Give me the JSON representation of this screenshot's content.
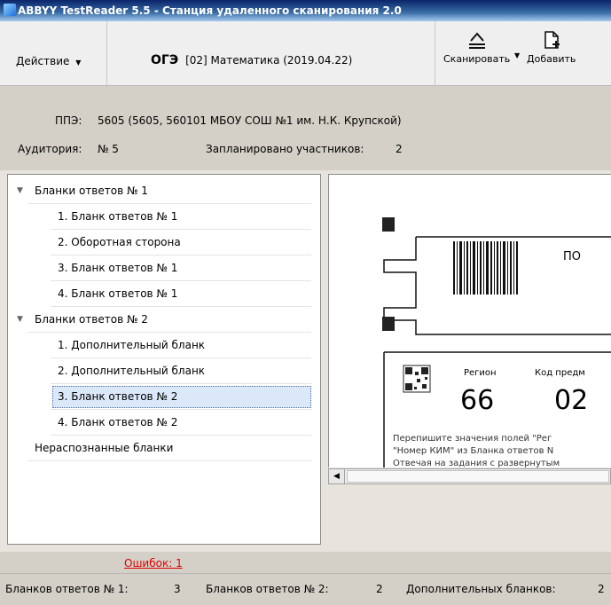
{
  "window": {
    "title": "ABBYY TestReader 5.5 - Станция удаленного сканирования 2.0"
  },
  "toolbar": {
    "action_label": "Действие",
    "exam_code": "ОГЭ",
    "exam_subject": "[02] Математика (2019.04.22)",
    "scan_label": "Сканировать",
    "add_label": "Добавить"
  },
  "info": {
    "ppe_label": "ППЭ:",
    "ppe_value": "5605 (5605, 560101 МБОУ СОШ №1 им. Н.К. Крупской)",
    "room_label": "Аудитория:",
    "room_value": "№ 5",
    "planned_label": "Запланировано участников:",
    "planned_value": "2"
  },
  "tree": {
    "items": [
      {
        "label": "Бланки ответов № 1",
        "kind": "group"
      },
      {
        "label": "1. Бланк ответов № 1",
        "kind": "child"
      },
      {
        "label": "2. Оборотная сторона",
        "kind": "child"
      },
      {
        "label": "3. Бланк ответов № 1",
        "kind": "child"
      },
      {
        "label": "4. Бланк ответов № 1",
        "kind": "child"
      },
      {
        "label": "Бланки ответов № 2",
        "kind": "group"
      },
      {
        "label": "1. Дополнительный бланк",
        "kind": "child"
      },
      {
        "label": "2. Дополнительный бланк",
        "kind": "child"
      },
      {
        "label": "3. Бланк ответов № 2",
        "kind": "child",
        "selected": true
      },
      {
        "label": "4. Бланк ответов № 2",
        "kind": "child"
      },
      {
        "label": "Нераспознанные бланки",
        "kind": "leaf"
      }
    ]
  },
  "preview": {
    "header_text": "ПО",
    "region_label": "Регион",
    "subject_code_label": "Код предм",
    "region_value": "66",
    "subject_code_value": "02",
    "note_line1": "Перепишите значения полей \"Рег",
    "note_line2": "\"Номер КИМ\" из Бланка ответов N",
    "note_line3": "Отвечая на задания с развернутым"
  },
  "errors_link": "Ошибок: 1",
  "status": {
    "answers1_label": "Бланков ответов № 1:",
    "answers1_value": "3",
    "answers2_label": "Бланков ответов № 2:",
    "answers2_value": "2",
    "extra_label": "Дополнительных бланков:",
    "extra_value": "2"
  },
  "colors": {
    "title_bar": "#0a246a",
    "error_link": "#e00000",
    "selection": "#dbe8f9"
  }
}
